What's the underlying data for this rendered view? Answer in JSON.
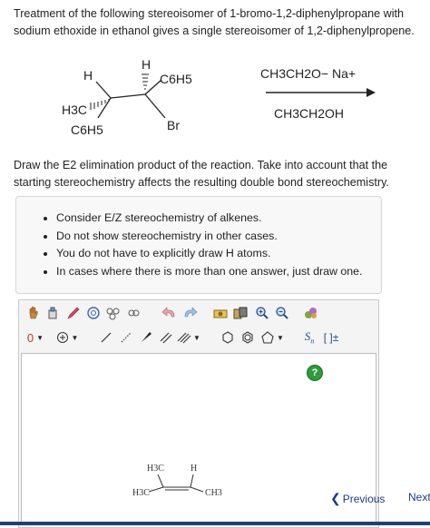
{
  "question": {
    "intro": "Treatment of the following stereoisomer of 1-bromo-1,2-diphenylpropane with sodium ethoxide in ethanol gives a single stereoisomer of 1,2-diphenylpropene."
  },
  "scheme": {
    "reactant": {
      "h_left": "H",
      "h_top": "H",
      "ph_top": "C6H5",
      "ch3": "H3C",
      "br": "Br",
      "ph_bottom": "C6H5"
    },
    "reagent_above": "CH3CH2O− Na+",
    "reagent_below": "CH3CH2OH"
  },
  "instruction": "Draw the E2 elimination product of the reaction. Take into account that the starting stereochemistry affects the resulting double bond stereochemistry.",
  "hints": [
    "Consider E/Z stereochemistry of alkenes.",
    "Do not show stereochemistry in other cases.",
    "You do not have to explicitly draw H atoms.",
    "In cases where there is more than one answer, just draw one."
  ],
  "editor": {
    "toolbar_top": [
      "hand-icon",
      "eraser-icon",
      "pencil-icon",
      "ring-template-icon",
      "chain-template-icon",
      "undo-icon",
      "redo-icon",
      "clean-icon",
      "copy-icon",
      "zoom-in-icon",
      "zoom-out-icon",
      "color-icon"
    ],
    "toolbar_bottom": [
      "charge-minus",
      "charge-plus",
      "single-bond",
      "wedge-bond",
      "dash-bond",
      "double-bond",
      "triple-bond",
      "hexagon",
      "pentagon",
      "triangle",
      "sn-icon",
      "bracket-icon"
    ],
    "charge_label": "0",
    "help_label": "?",
    "canvas_labels": {
      "h3c_top": "H3C",
      "h_top": "H",
      "h3c_left": "H3C",
      "ch3_right": "CH3"
    }
  },
  "nav": {
    "previous": "Previous",
    "next": "Next"
  },
  "colors": {
    "accent": "#1a3b8a",
    "help": "#2e9c3a",
    "bottom_bar": "#1f3f7a"
  }
}
